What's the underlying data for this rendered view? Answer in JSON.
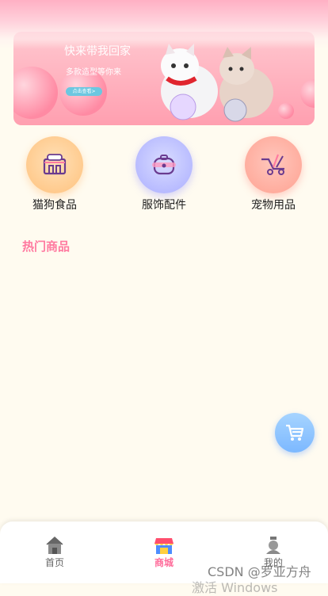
{
  "banner": {
    "title": "快来带我回家",
    "subtitle": "多款造型等你来",
    "button": "点击查看>"
  },
  "categories": [
    {
      "label": "猫狗食品",
      "icon": "pet-food-icon"
    },
    {
      "label": "服饰配件",
      "icon": "accessory-icon"
    },
    {
      "label": "宠物用品",
      "icon": "pet-supplies-icon"
    }
  ],
  "section": {
    "hot_title": "热门商品"
  },
  "tabs": [
    {
      "label": "首页",
      "icon": "home-icon"
    },
    {
      "label": "商城",
      "icon": "shop-icon",
      "active": true
    },
    {
      "label": "我的",
      "icon": "profile-icon"
    }
  ],
  "watermark": {
    "line1": "CSDN @罗亚方舟",
    "line2": "激活 Windows"
  },
  "colors": {
    "accent": "#ff6b9a",
    "background": "#fffbf0",
    "fab": "#8fc6ff"
  }
}
